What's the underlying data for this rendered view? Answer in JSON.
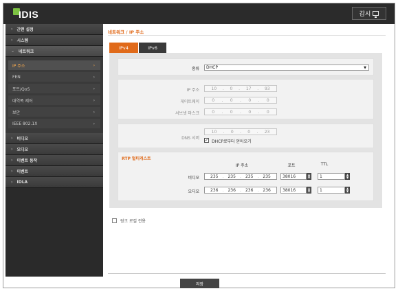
{
  "header": {
    "logo": "IDIS",
    "live_button": "감시"
  },
  "sidebar": {
    "top_items": [
      "간편 설정",
      "시스템"
    ],
    "open_item": "네트워크",
    "sub_items": [
      "IP 주소",
      "FEN",
      "포트/QoS",
      "대역폭 제어",
      "보안",
      "IEEE 802.1X"
    ],
    "active_sub": "IP 주소",
    "bottom_items": [
      "비디오",
      "오디오",
      "이벤트 동작",
      "이벤트",
      "IDLA"
    ]
  },
  "breadcrumb": "네트워크 / IP 주소",
  "tabs": [
    "IPv4",
    "IPv6"
  ],
  "form": {
    "type_label": "종류",
    "type_value": "DHCP",
    "ip_label": "IP 주소",
    "ip": [
      "10",
      "0",
      "17",
      "93"
    ],
    "gateway_label": "게이트웨이",
    "gateway": [
      "0",
      "0",
      "0",
      "0"
    ],
    "subnet_label": "서브넷 마스크",
    "subnet": [
      "0",
      "0",
      "0",
      "0"
    ],
    "dns_label": "DNS 서버",
    "dns": [
      "10",
      "0",
      "0",
      "23"
    ],
    "dns_dhcp_label": "DHCP로부터 얻어오기",
    "dns_dhcp_checked": true
  },
  "rtp": {
    "title": "RTP 멀티캐스트",
    "col_ip": "IP 주소",
    "col_port": "포트",
    "col_ttl": "TTL",
    "video_label": "비디오",
    "video_ip": [
      "235",
      "235",
      "235",
      "235"
    ],
    "video_port": "38016",
    "video_ttl": "1",
    "audio_label": "오디오",
    "audio_ip": [
      "236",
      "236",
      "236",
      "236"
    ],
    "audio_port": "38016",
    "audio_ttl": "1"
  },
  "link_local_label": "링크 로컬 전용",
  "save_label": "저장",
  "colors": {
    "accent": "#e06a1a",
    "sidebar_bg": "#2a2a2a",
    "header_bg": "#2b2b2b",
    "logo_green": "#7cc242"
  }
}
